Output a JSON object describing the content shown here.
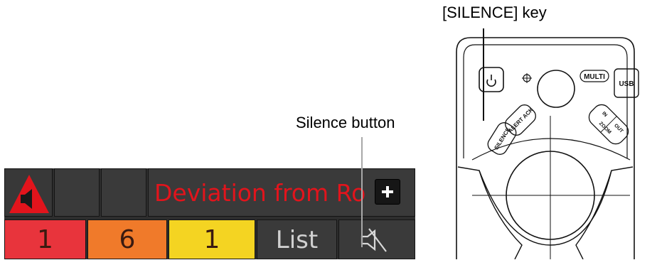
{
  "callouts": {
    "silence_button": "Silence button",
    "silence_key": "[SILENCE] key"
  },
  "alert_panel": {
    "icon": "speaker-warning-icon",
    "message": "Deviation from Ro",
    "expand_icon": "plus-icon",
    "counts": [
      {
        "value": "1",
        "color": "#e8343c"
      },
      {
        "value": "6",
        "color": "#f07a2a"
      },
      {
        "value": "1",
        "color": "#f4d422"
      }
    ],
    "list_label": "List",
    "silence_icon": "speaker-muted-icon",
    "message_color": "#e2141c"
  },
  "keypad": {
    "multi_label": "MULTI",
    "usb_label": "USB",
    "alert_ack_label": "ALERT ACK",
    "silence_label": "SILENCE",
    "zoom_in_label": "IN",
    "zoom_label": "ZOOM",
    "zoom_out_label": "OUT",
    "power_icon": "power-icon"
  }
}
